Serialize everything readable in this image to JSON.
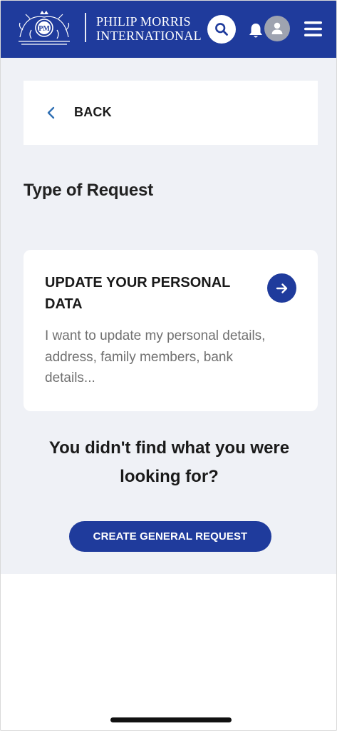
{
  "header": {
    "brand_line1": "PHILIP MORRIS",
    "brand_line2": "INTERNATIONAL",
    "crest_initials": "PM",
    "icons": [
      "pmi-crest-logo",
      "search-icon",
      "bell-icon",
      "user-avatar-icon",
      "hamburger-menu-icon"
    ],
    "accent_color": "#1f3b9c"
  },
  "nav": {
    "back_label": "BACK"
  },
  "page": {
    "title": "Type of Request"
  },
  "request_card": {
    "title": "UPDATE YOUR PERSONAL DATA",
    "description": "I want to update my personal details, address, family members, bank details..."
  },
  "footer_prompt": {
    "text": "You didn't find what you were looking for?",
    "button_label": "CREATE GENERAL REQUEST"
  },
  "colors": {
    "background": "#eff1f6",
    "primary": "#1f3b9c",
    "card": "#ffffff"
  }
}
